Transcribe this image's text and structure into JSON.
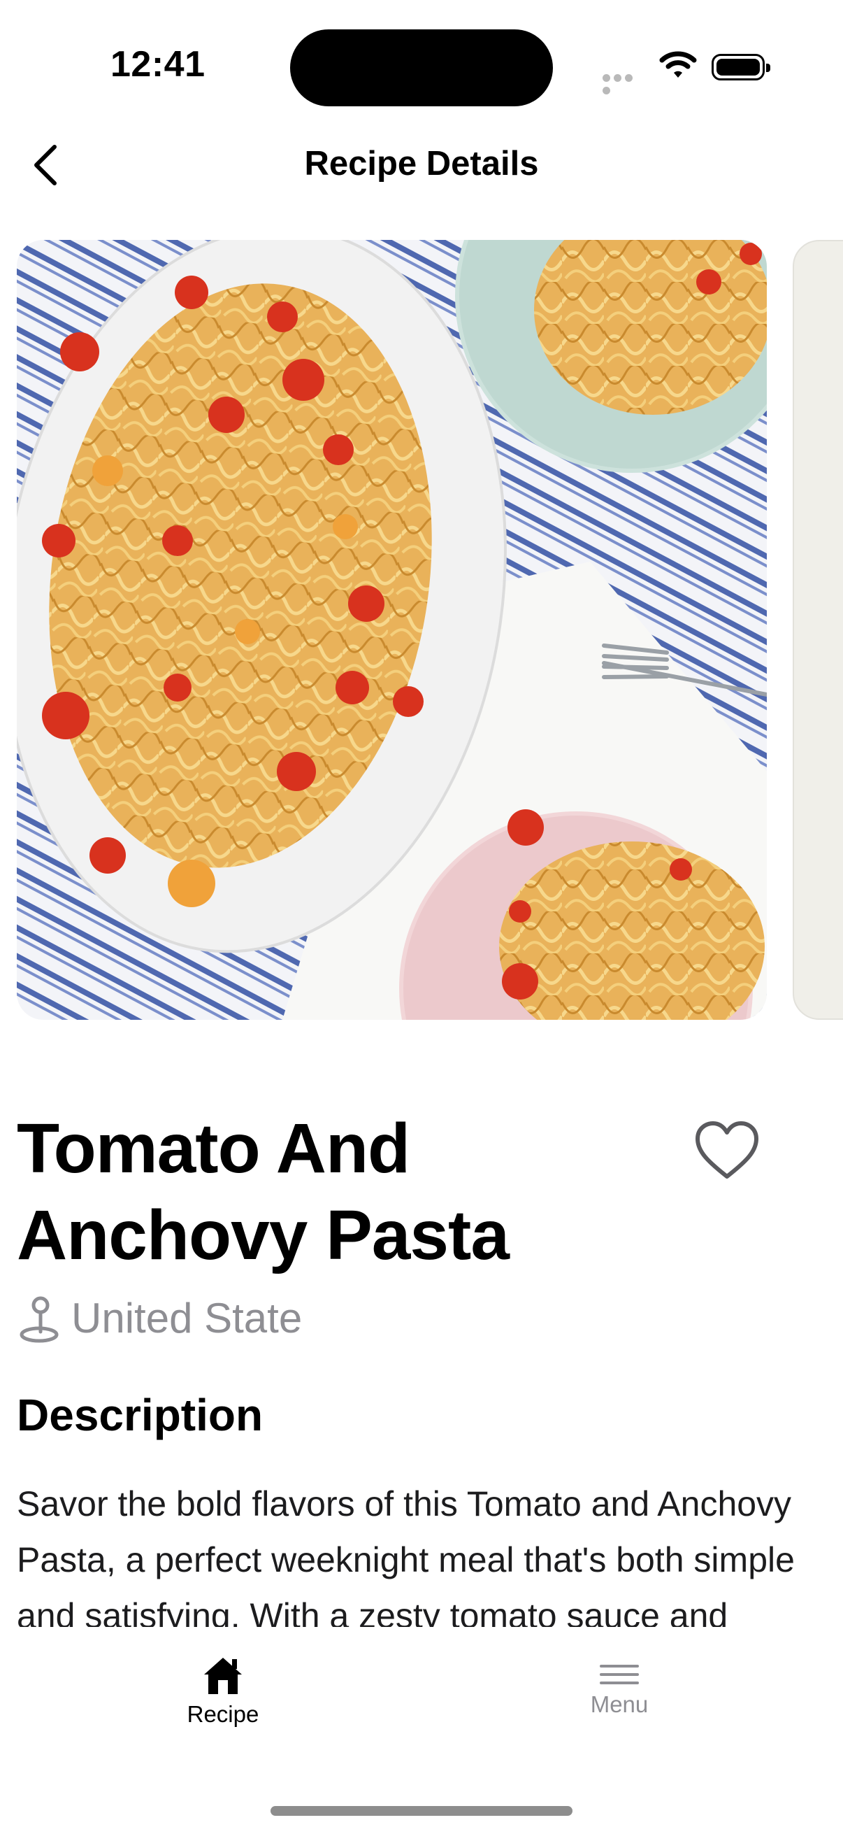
{
  "status_bar": {
    "time": "12:41"
  },
  "nav": {
    "title": "Recipe Details",
    "back_icon": "chevron-left-icon"
  },
  "recipe": {
    "title_line1": "Tomato And",
    "title_line2": "Anchovy Pasta",
    "location": "United State",
    "favorite_icon": "heart-outline-icon",
    "location_icon": "map-pin-icon"
  },
  "description": {
    "heading": "Description",
    "text": "Savor the bold flavors of this Tomato and Anchovy Pasta, a perfect weeknight meal that's both simple and satisfying. With a zesty tomato sauce and"
  },
  "tabbar": {
    "tabs": [
      {
        "label": "Recipe",
        "icon": "home-icon",
        "active": true
      },
      {
        "label": "Menu",
        "icon": "menu-icon",
        "active": false
      }
    ]
  },
  "colors": {
    "active_tab": "#000000",
    "inactive_tab": "#8e8e93",
    "secondary_text": "#8e8e93"
  }
}
